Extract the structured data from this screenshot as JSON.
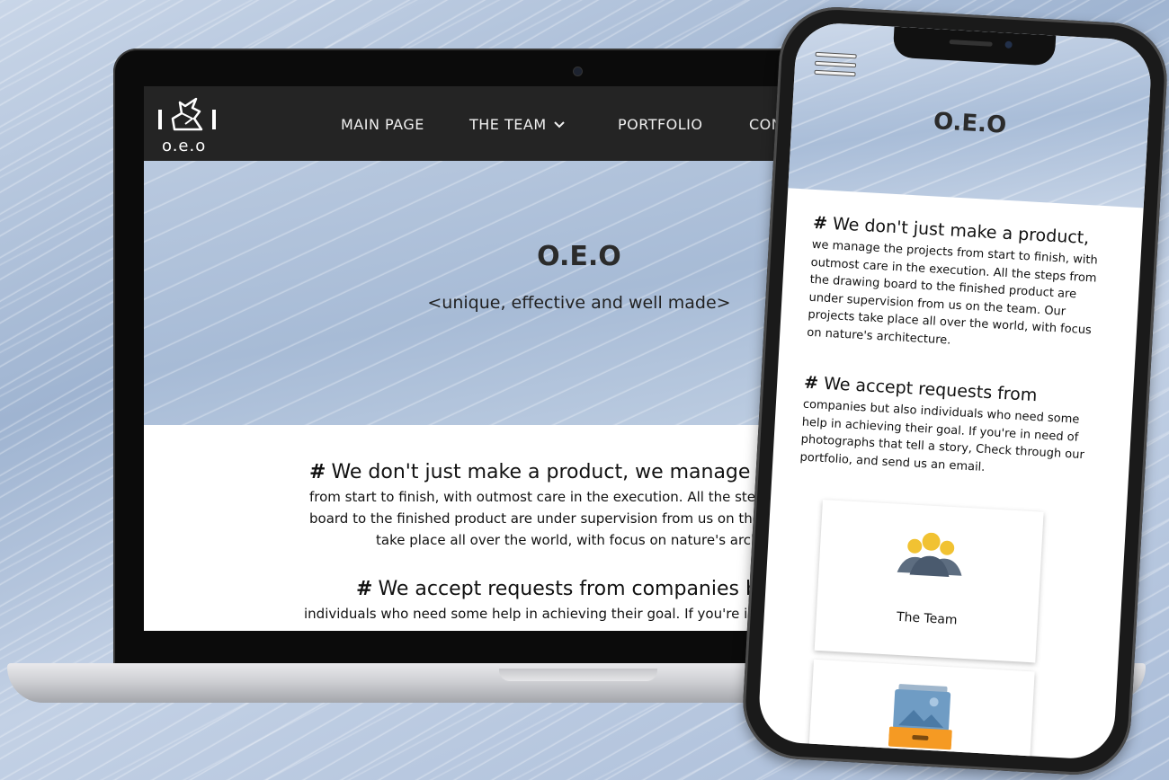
{
  "laptop": {
    "logo_text": "o.e.o",
    "nav": [
      "MAIN PAGE",
      "THE TEAM",
      "PORTFOLIO",
      "CONTACT"
    ],
    "hero_title": "O.E.O",
    "hero_subtitle": "<unique, effective and well made>",
    "section1_heading": "We don't just make a product, we manage the",
    "section1_lines": [
      "from start to finish, with outmost care in the execution. All the steps from",
      "board to the finished product are under supervision from us on the team.",
      "take place all over the world, with focus on nature's architectur"
    ],
    "section2_heading": "We accept requests from companies but",
    "section2_lines": [
      "individuals who need some help in achieving their goal. If you're in need o"
    ]
  },
  "phone": {
    "hero_title": "O.E.O",
    "section1_heading": "We don't just make a product,",
    "section1_lines": [
      "we manage the projects from start to finish, with",
      "outmost care in the execution. All the steps from",
      "the drawing board to the finished product are",
      "under supervision from us on the team. Our",
      "projects take place all over the world, with focus",
      "on nature's architecture."
    ],
    "section2_heading": "We accept requests from",
    "section2_lines": [
      "companies but also individuals who need some",
      "help in achieving their goal. If you're in need of",
      "photographs that tell a story, Check through our",
      "portfolio, and send us an email."
    ],
    "card1_label": "The Team"
  },
  "colors": {
    "nav_bg": "#242424",
    "accent_yellow": "#f1c232",
    "icon_gray": "#5d6d80"
  },
  "icons": [
    "logo-origami-icon",
    "chevron-down-icon",
    "hash-icon",
    "hamburger-icon",
    "team-icon",
    "gallery-icon"
  ]
}
